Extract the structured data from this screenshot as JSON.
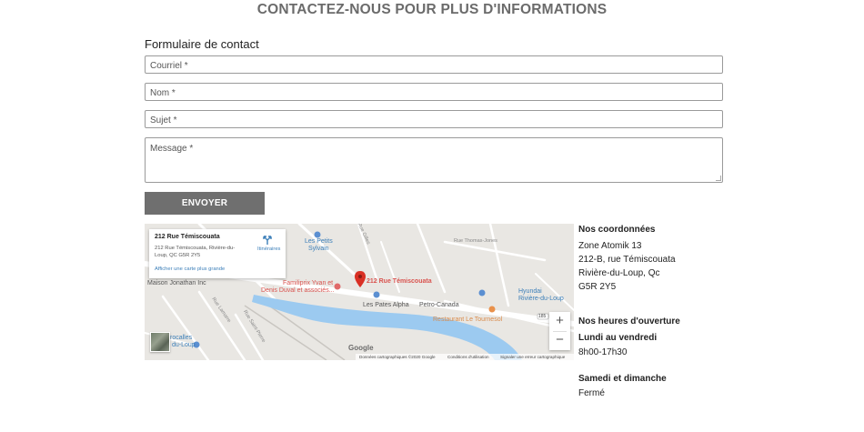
{
  "page": {
    "title": "CONTACTEZ-NOUS POUR PLUS D'INFORMATIONS"
  },
  "form": {
    "heading": "Formulaire de contact",
    "email_placeholder": "Courriel *",
    "name_placeholder": "Nom *",
    "subject_placeholder": "Sujet *",
    "message_placeholder": "Message *",
    "submit_label": "ENVOYER"
  },
  "map": {
    "card": {
      "place_name": "212 Rue Témiscouata",
      "address_line": "212 Rue Témiscouata, Rivière-du-Loup, QC G5R 2Y5",
      "larger_map_link": "Afficher une carte plus grande",
      "directions_label": "Itinéraires"
    },
    "labels": {
      "pin": "212 Rue Témiscouata",
      "maison": "Maison Jonathan Inc",
      "petits_1": "Les Petits",
      "petits_2": "Sylvain",
      "familiprix": "Familiprix Yvan et",
      "familiprix_2": "Denis Duval et associés...",
      "pates": "Les Pates Alpha",
      "petro": "Petro-Canada",
      "restaurant": "Restaurant Le Tournesol",
      "hyundai_1": "Hyundai",
      "hyundai_2": "Rivière-du-Loup",
      "grocalles": "rocalles",
      "grocalles_2": "du-Loup",
      "road_thomas": "Rue Thomas-Jones",
      "road_gilles": "Rue Gilles",
      "road_lamarre": "Rue Lamarre",
      "road_saint_pierre": "Rue Saint-Pierre",
      "route": "185"
    },
    "zoom_in": "+",
    "zoom_out": "−",
    "google_logo": "Google",
    "footer": {
      "data": "Données cartographiques ©2020 Google",
      "terms": "Conditions d'utilisation",
      "report": "Signaler une erreur cartographique"
    },
    "colors": {
      "background": "#e9e7e3",
      "river": "#9ccaf0",
      "road": "#ffffff",
      "pin": "#d93025"
    }
  },
  "contact": {
    "coords_heading": "Nos coordonnées",
    "line1": "Zone Atomik 13",
    "line2": "212-B, rue Témiscouata",
    "line3": "Rivière-du-Loup, Qc",
    "line4": "G5R 2Y5",
    "hours_heading": "Nos heures d'ouverture",
    "weekdays_label": "Lundi au vendredi",
    "weekdays_hours": "8h00-17h30",
    "weekend_label": "Samedi et dimanche",
    "weekend_hours": "Fermé"
  },
  "colors": {
    "title": "#6b6b6b",
    "button": "#6f6f6f",
    "field_border": "#9a9a9a"
  }
}
